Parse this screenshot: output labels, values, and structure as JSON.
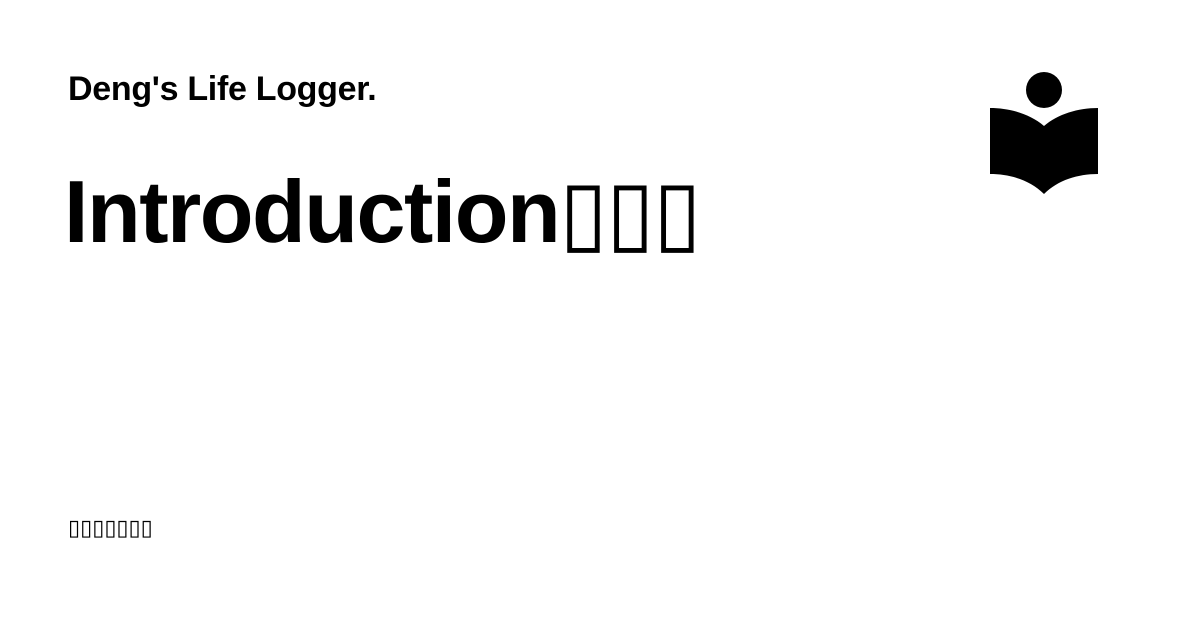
{
  "site": {
    "name": "Deng's Life Logger."
  },
  "page": {
    "title": "Introduction▯▯▯",
    "footer": "▯▯▯▯▯▯▯"
  },
  "logo": {
    "icon": "reader-book-icon",
    "color": "#000000"
  }
}
